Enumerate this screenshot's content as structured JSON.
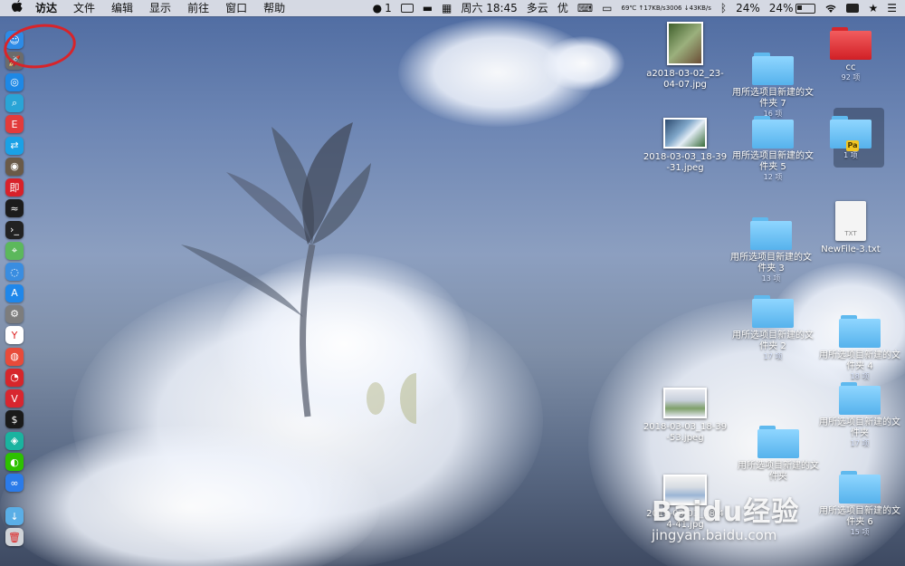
{
  "menubar": {
    "apple": "",
    "items": [
      "访达",
      "文件",
      "编辑",
      "显示",
      "前往",
      "窗口",
      "帮助"
    ],
    "wechat_count": "1",
    "clock": "周六 18:45",
    "weather": "多云",
    "air_quality": "优",
    "temp": "69℃",
    "fan": "3006",
    "net_up": "↑17KB/s",
    "net_down": "↓43KB/s",
    "cpu_percent": "24%",
    "battery_percent": "24%",
    "battery_level": 0.24
  },
  "dock": {
    "icons": [
      {
        "name": "finder-icon",
        "color": "#2d8be6"
      },
      {
        "name": "launchpad-icon",
        "color": "#6b6b6b"
      },
      {
        "name": "safari-icon",
        "color": "#1e88e5"
      },
      {
        "name": "preview-icon",
        "color": "#2aa4d6"
      },
      {
        "name": "app-red-icon",
        "color": "#e23b3b"
      },
      {
        "name": "migration-icon",
        "color": "#1aa1e6"
      },
      {
        "name": "photo-app-icon",
        "color": "#6a5a48"
      },
      {
        "name": "app-red-square-icon",
        "color": "#d8212a"
      },
      {
        "name": "activity-monitor-icon",
        "color": "#1c1c1c"
      },
      {
        "name": "terminal-icon",
        "color": "#222222"
      },
      {
        "name": "maps-icon",
        "color": "#5cb85c"
      },
      {
        "name": "siri-icon",
        "color": "#3a8de0"
      },
      {
        "name": "app-store-icon",
        "color": "#1f87ea"
      },
      {
        "name": "system-preferences-icon",
        "color": "#7d7d7d"
      },
      {
        "name": "yandex-icon",
        "color": "#ffffff"
      },
      {
        "name": "chrome-icon",
        "color": "#e84b3a"
      },
      {
        "name": "netease-music-icon",
        "color": "#d6262b"
      },
      {
        "name": "vivaldi-icon",
        "color": "#d8262f"
      },
      {
        "name": "iterm-icon",
        "color": "#1a1a1a"
      },
      {
        "name": "app-teal-icon",
        "color": "#1ab39f"
      },
      {
        "name": "wechat-icon",
        "color": "#2dc100"
      },
      {
        "name": "baidu-netdisk-icon",
        "color": "#2b7be9"
      },
      {
        "name": "downloads-folder-icon",
        "color": "#5aaee6"
      },
      {
        "name": "trash-icon",
        "color": "#cfd3d8"
      }
    ]
  },
  "desktop": {
    "items": [
      {
        "label": "a2018-03-02_23-\n04-07.jpg",
        "count": "",
        "kind": "photo-tall"
      },
      {
        "label": "用所选项目新建的文\n件夹 7",
        "count": "16 项",
        "kind": "folder"
      },
      {
        "label": "cc",
        "count": "92 项",
        "kind": "folder-red"
      },
      {
        "label": "2018-03-03_18-39\n-31.jpeg",
        "count": "",
        "kind": "photo"
      },
      {
        "label": "用所选项目新建的文\n件夹 5",
        "count": "12 项",
        "kind": "folder"
      },
      {
        "label": "Pa",
        "count": "1 项",
        "kind": "folder-pa"
      },
      {
        "label": "NewFile-3.txt",
        "count": "",
        "kind": "txt",
        "icon_text": "TXT"
      },
      {
        "label": "用所选项目新建的文\n件夹 3",
        "count": "13 项",
        "kind": "folder"
      },
      {
        "label": "用所选项目新建的文\n件夹 2",
        "count": "17 项",
        "kind": "folder"
      },
      {
        "label": "用所选项目新建的文\n件夹 4",
        "count": "18 项",
        "kind": "folder"
      },
      {
        "label": "2018-03-03_18-39\n-53.jpeg",
        "count": "",
        "kind": "photo"
      },
      {
        "label": "用所选项目新建的文\n件夹",
        "count": "17 项",
        "kind": "folder"
      },
      {
        "label": "用所选项目新建的文\n件夹",
        "count": "",
        "kind": "folder"
      },
      {
        "label": "2018-03-03_18-4\n4-41.jpg",
        "count": "",
        "kind": "photo"
      },
      {
        "label": "用所选项目新建的文\n件夹 6",
        "count": "15 项",
        "kind": "folder"
      }
    ]
  },
  "watermark": {
    "brand": "Baidu经验",
    "url": "jingyan.baidu.com"
  },
  "colors": {
    "annotation": "#d8242a",
    "folder": "#6ec4f5"
  }
}
